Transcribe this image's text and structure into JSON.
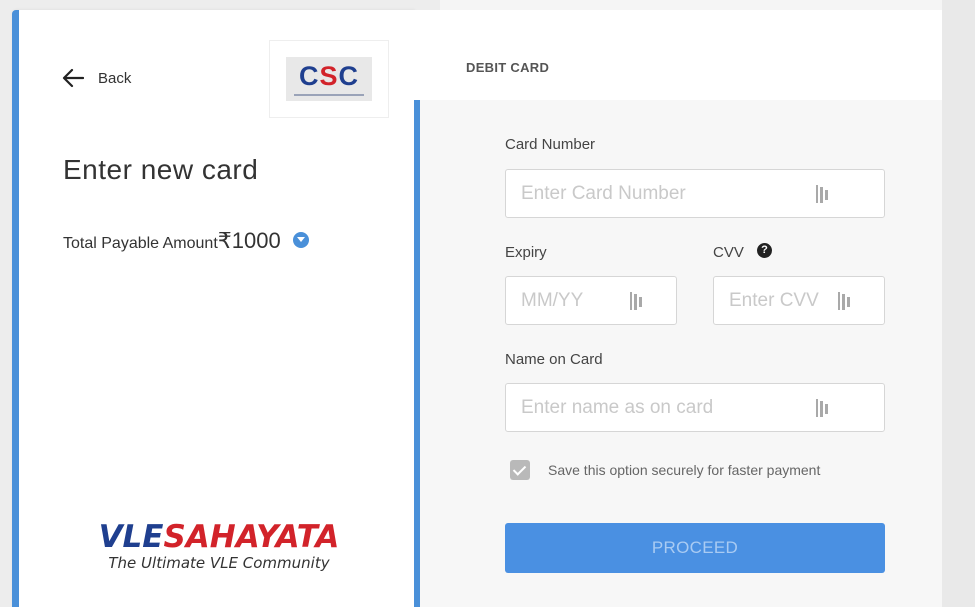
{
  "left": {
    "back_label": "Back",
    "merchant_logo": {
      "text_left": "C",
      "text_mid": "S",
      "text_right": "C"
    },
    "heading": "Enter new card",
    "amount_label": "Total Payable Amount",
    "amount_value": "₹1000",
    "brand": {
      "part1": "VLE",
      "part2": "SAHAYATA",
      "tagline": "The Ultimate VLE Community"
    }
  },
  "right": {
    "tab_label": "DEBIT CARD",
    "card_number": {
      "label": "Card Number",
      "placeholder": "Enter Card Number"
    },
    "expiry": {
      "label": "Expiry",
      "placeholder": "MM/YY"
    },
    "cvv": {
      "label": "CVV",
      "placeholder": "Enter CVV"
    },
    "name": {
      "label": "Name on Card",
      "placeholder": "Enter name as on card"
    },
    "save_option": {
      "label": "Save this option securely for faster payment",
      "checked": true
    },
    "proceed_label": "PROCEED"
  },
  "colors": {
    "accent": "#4a90d9",
    "button": "#4a90e2",
    "brand_blue": "#1f3f8f",
    "brand_red": "#d2232a"
  }
}
